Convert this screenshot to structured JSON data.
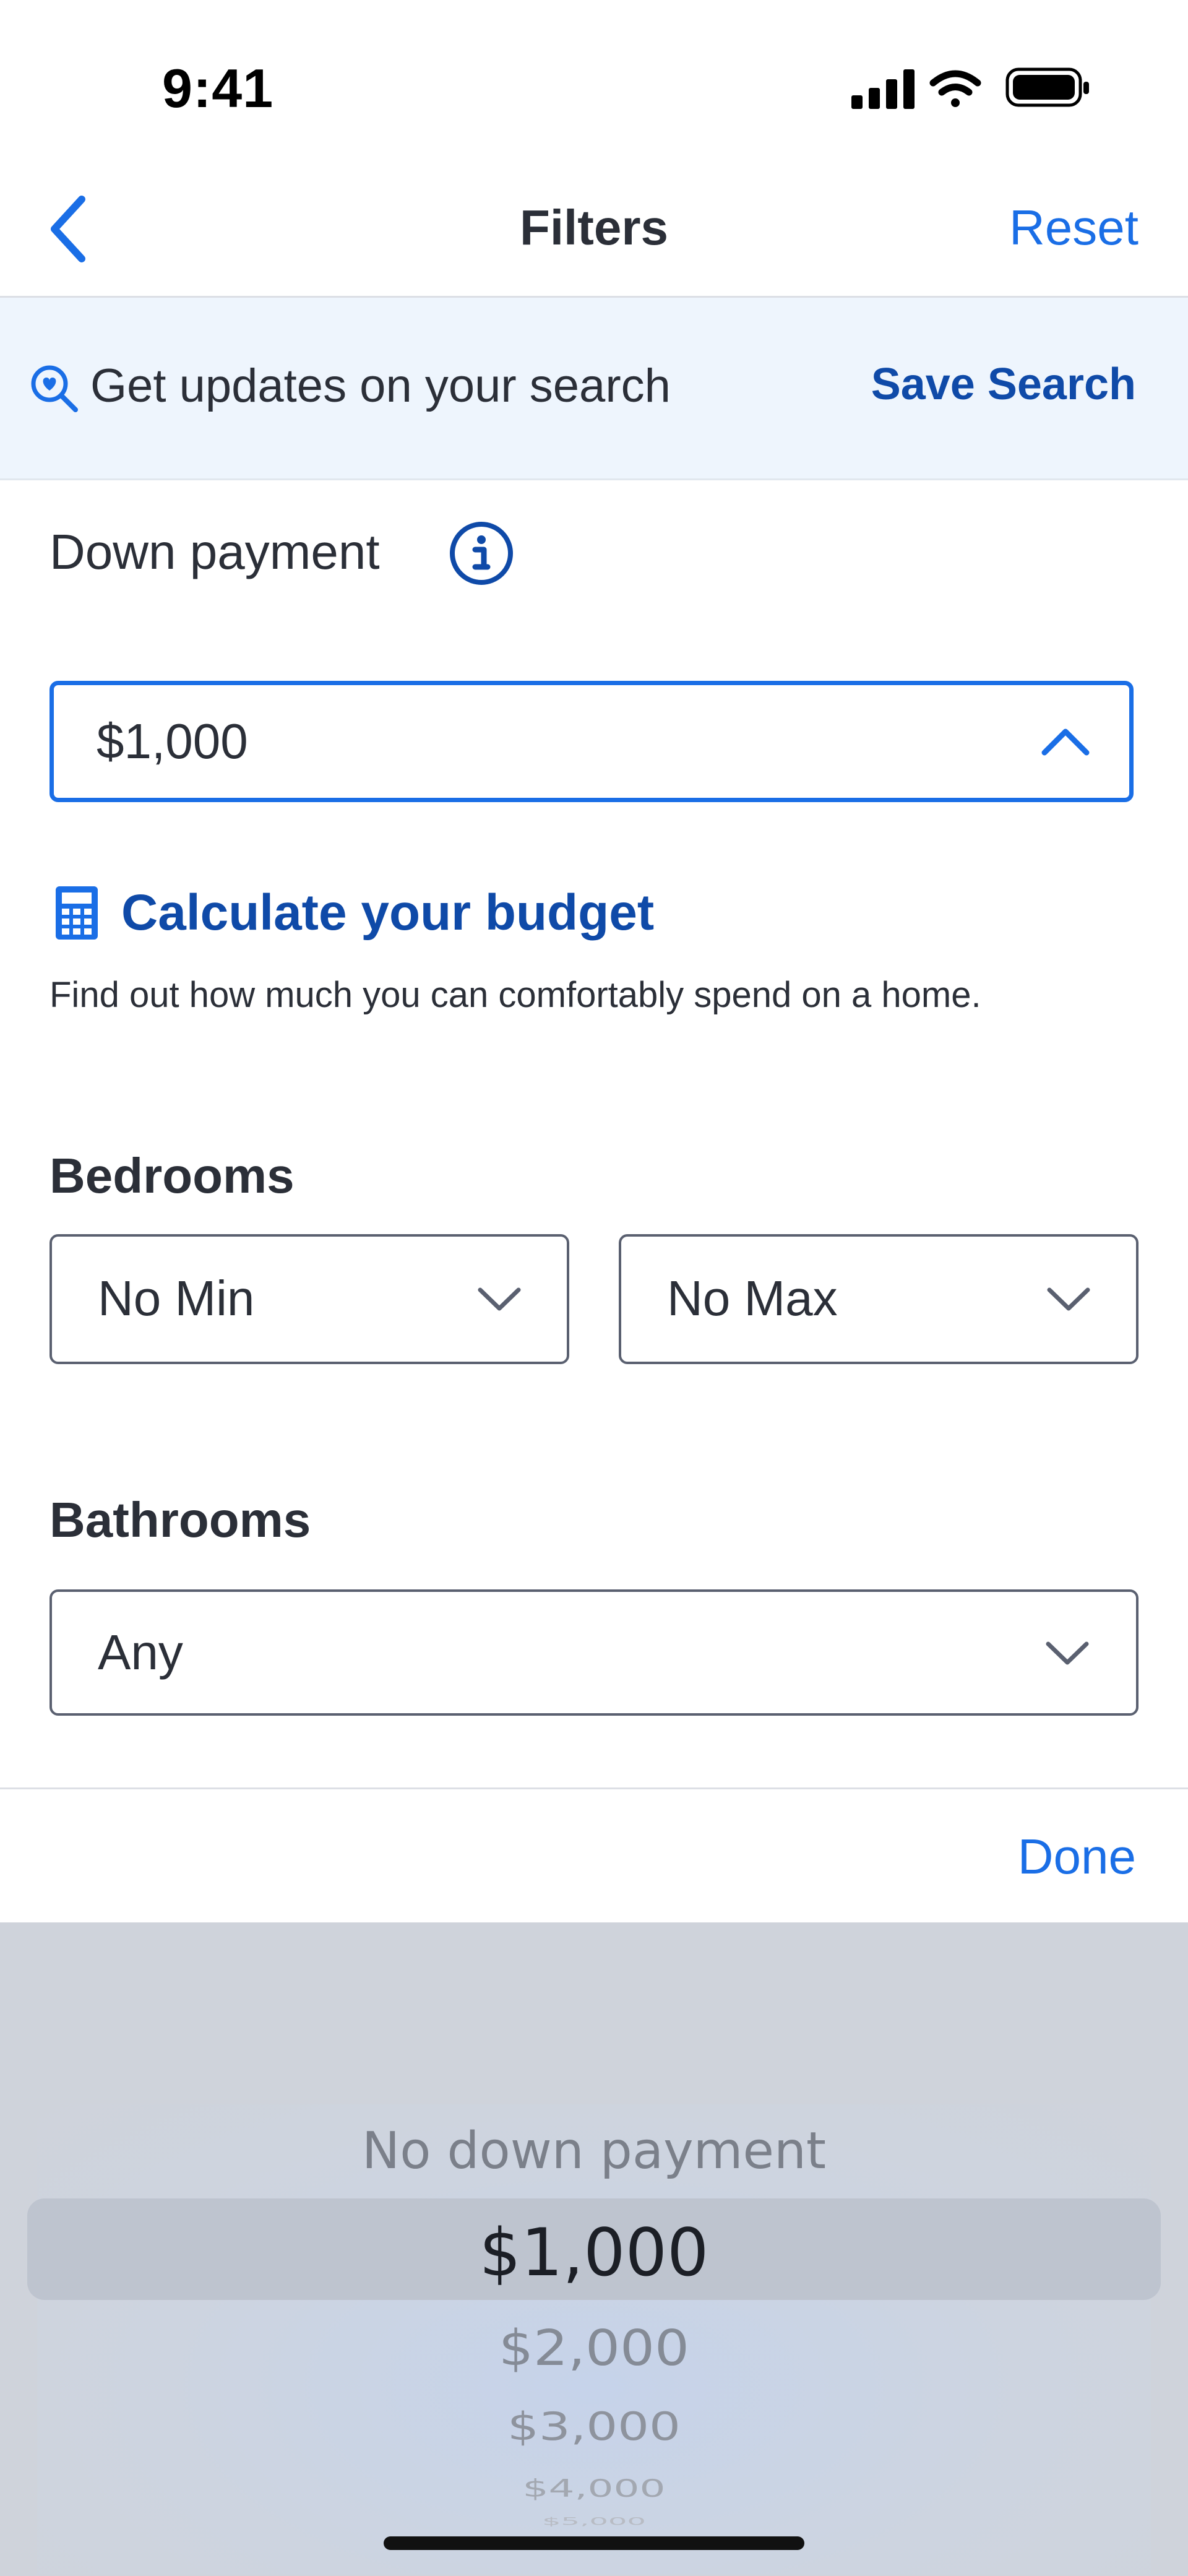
{
  "status_bar": {
    "time": "9:41"
  },
  "nav": {
    "title": "Filters",
    "reset_label": "Reset"
  },
  "banner": {
    "text": "Get updates on your search",
    "save_label": "Save Search"
  },
  "down_payment": {
    "label": "Down payment",
    "value": "$1,000"
  },
  "calculator": {
    "link": "Calculate your budget",
    "description": "Find out how much you can comfortably spend on a home."
  },
  "bedrooms": {
    "label": "Bedrooms",
    "min": "No Min",
    "max": "No Max"
  },
  "bathrooms": {
    "label": "Bathrooms",
    "value": "Any"
  },
  "picker": {
    "done_label": "Done",
    "options": [
      "No down payment",
      "$1,000",
      "$2,000",
      "$3,000",
      "$4,000",
      "$5,000"
    ],
    "selected": "$1,000"
  },
  "colors": {
    "accent": "#1a6ee6",
    "brand_dark": "#0f4aa8",
    "banner_bg": "#eef5fd",
    "picker_bg": "#cfd3db"
  }
}
